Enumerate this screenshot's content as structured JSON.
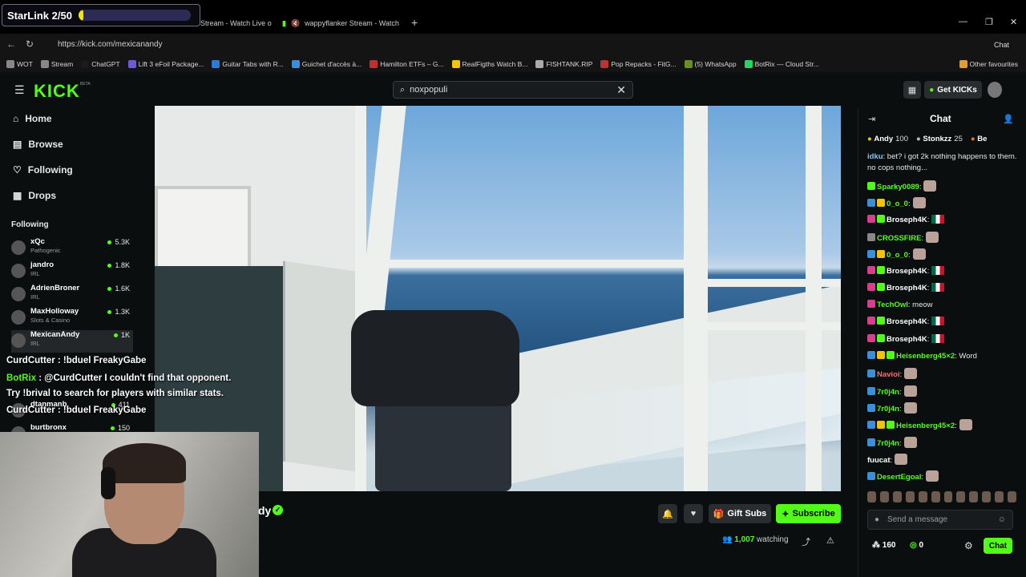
{
  "overlay": {
    "goal_label": "StarLink 2/50",
    "goal_progress": 0.04
  },
  "browser": {
    "tabs": [
      {
        "label": "Stream - Watch Live o"
      },
      {
        "label": "wappyflanker Stream - Watch"
      }
    ],
    "new_tab": "+",
    "url": "https://kick.com/mexicanandy",
    "bookmarks": [
      "WOT",
      "Stream",
      "ChatGPT",
      "Lift 3 eFoil Package...",
      "Guitar Tabs with R...",
      "Guichet d'accès à...",
      "Hamilton ETFs – G...",
      "RealFigths Watch B...",
      "FISHTANK.RIP",
      "Pop Repacks - FitG...",
      "(5) WhatsApp",
      "BotRix — Cloud Str...",
      "Other favourites"
    ],
    "colors": {
      "brand": "#53fc18"
    }
  },
  "kick": {
    "logo": "KICK",
    "beta": "BETA",
    "search_value": "noxpopuli",
    "get_kicks": "Get KICKs"
  },
  "sidebar": {
    "nav": [
      {
        "label": "Home",
        "icon": "home-icon"
      },
      {
        "label": "Browse",
        "icon": "browse-icon"
      },
      {
        "label": "Following",
        "icon": "heart-icon"
      },
      {
        "label": "Drops",
        "icon": "drops-icon"
      }
    ],
    "following_title": "Following",
    "channels": [
      {
        "name": "xQc",
        "category": "Pathogenic",
        "viewers": "5.3K"
      },
      {
        "name": "jandro",
        "category": "IRL",
        "viewers": "1.8K"
      },
      {
        "name": "AdrienBroner",
        "category": "IRL",
        "viewers": "1.6K"
      },
      {
        "name": "MaxHolloway",
        "category": "Slots & Casino",
        "viewers": "1.3K"
      },
      {
        "name": "MexicanAndy",
        "category": "IRL",
        "viewers": "1K"
      },
      {
        "name": "dtanmanb",
        "category": "",
        "viewers": "411"
      },
      {
        "name": "burtbronx",
        "category": "",
        "viewers": "150"
      }
    ]
  },
  "video_overlay_chat": [
    {
      "user": "CurdCutter",
      "text": " : !bduel FreakyGabe"
    },
    {
      "user": "BotRix",
      "text": " : @CurdCutter I couldn't find that opponent."
    },
    {
      "user": "",
      "text": "Try !brival to search for players with similar stats."
    },
    {
      "user": "CurdCutter",
      "text": " : !bduel FreakyGabe"
    }
  ],
  "stream": {
    "name_partial": "dy",
    "gift_subs": "Gift Subs",
    "subscribe": "Subscribe",
    "watching_count": "1,007",
    "watching_label": "watching"
  },
  "chat": {
    "title": "Chat",
    "leaderboard": [
      {
        "name": "Andy",
        "value": "100"
      },
      {
        "name": "Stonkzz",
        "value": "25"
      },
      {
        "name": "Be",
        "value": ""
      }
    ],
    "messages": [
      {
        "user": "idku",
        "color": "#7ec8ff",
        "text": ": bet? i got 2k nothing happens to them. no cops nothing...",
        "badges": [],
        "emote": false,
        "flag": false
      },
      {
        "user": "Sparky0089",
        "color": "#53fc18",
        "text": ":",
        "badges": [
          "#53fc18"
        ],
        "emote": true,
        "flag": false
      },
      {
        "user": "0_o_0",
        "color": "#53fc18",
        "text": ":",
        "badges": [
          "#3a8fd6",
          "#f5c400"
        ],
        "emote": true,
        "flag": false
      },
      {
        "user": "Broseph4K",
        "color": "#fff",
        "text": ":",
        "badges": [
          "#d6408e",
          "#53fc18"
        ],
        "emote": false,
        "flag": true
      },
      {
        "user": "CROSSFIRE",
        "color": "#53fc18",
        "text": ":",
        "badges": [
          "#888"
        ],
        "emote": true,
        "flag": false
      },
      {
        "user": "0_o_0",
        "color": "#53fc18",
        "text": ":",
        "badges": [
          "#3a8fd6",
          "#f5c400"
        ],
        "emote": true,
        "flag": false
      },
      {
        "user": "Broseph4K",
        "color": "#fff",
        "text": ":",
        "badges": [
          "#d6408e",
          "#53fc18"
        ],
        "emote": false,
        "flag": true
      },
      {
        "user": "Broseph4K",
        "color": "#fff",
        "text": ":",
        "badges": [
          "#d6408e",
          "#53fc18"
        ],
        "emote": false,
        "flag": true
      },
      {
        "user": "TechOwl",
        "color": "#53fc18",
        "text": ": meow",
        "badges": [
          "#d6408e"
        ],
        "emote": false,
        "flag": false
      },
      {
        "user": "Broseph4K",
        "color": "#fff",
        "text": ":",
        "badges": [
          "#d6408e",
          "#53fc18"
        ],
        "emote": false,
        "flag": true
      },
      {
        "user": "Broseph4K",
        "color": "#fff",
        "text": ":",
        "badges": [
          "#d6408e",
          "#53fc18"
        ],
        "emote": false,
        "flag": true
      },
      {
        "user": "Heisenberg45×2",
        "color": "#53fc18",
        "text": ": Word",
        "badges": [
          "#3a8fd6",
          "#f5c400",
          "#53fc18"
        ],
        "emote": false,
        "flag": false
      },
      {
        "user": "Navioi",
        "color": "#ff6b6b",
        "text": ":",
        "badges": [
          "#3a8fd6"
        ],
        "emote": true,
        "flag": false
      },
      {
        "user": "7r0j4n",
        "color": "#53fc18",
        "text": ":",
        "badges": [
          "#3a8fd6"
        ],
        "emote": true,
        "flag": false
      },
      {
        "user": "7r0j4n",
        "color": "#53fc18",
        "text": ":",
        "badges": [
          "#3a8fd6"
        ],
        "emote": true,
        "flag": false
      },
      {
        "user": "Heisenberg45×2",
        "color": "#53fc18",
        "text": ":",
        "badges": [
          "#3a8fd6",
          "#f5c400",
          "#53fc18"
        ],
        "emote": true,
        "flag": false
      },
      {
        "user": "7r0j4n",
        "color": "#53fc18",
        "text": ":",
        "badges": [
          "#3a8fd6"
        ],
        "emote": true,
        "flag": false
      },
      {
        "user": "fuucat",
        "color": "#fff",
        "text": ":",
        "badges": [],
        "emote": true,
        "flag": false
      },
      {
        "user": "DesertEgoal",
        "color": "#53fc18",
        "text": ":",
        "badges": [
          "#3a8fd6"
        ],
        "emote": true,
        "flag": false
      }
    ],
    "input_placeholder": "Send a message",
    "send_label": "Chat",
    "kicks_balance": "160",
    "points_balance": "0"
  }
}
